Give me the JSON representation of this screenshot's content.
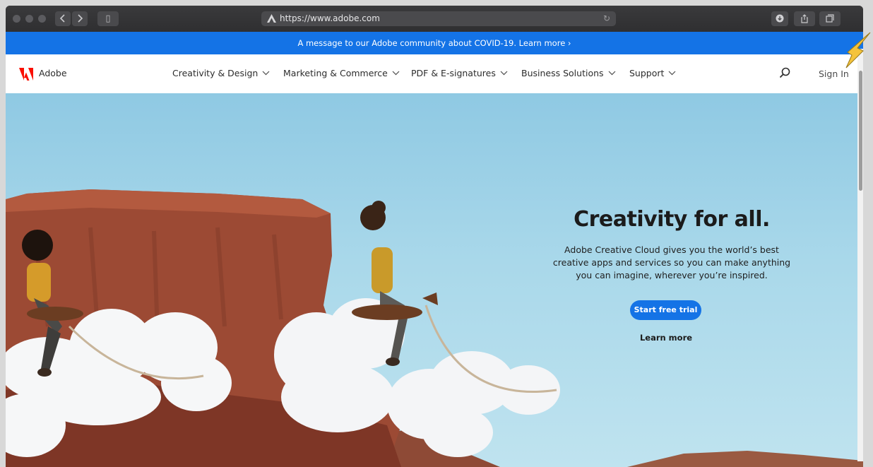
{
  "browser": {
    "url": "https://www.adobe.com",
    "reload_glyph": "↻",
    "sidebar_glyph": "▯"
  },
  "banner": {
    "text": "A message to our Adobe community about COVID-19. Learn more ›"
  },
  "nav": {
    "brand": "Adobe",
    "items": [
      {
        "label": "Creativity & Design"
      },
      {
        "label": "Marketing & Commerce"
      },
      {
        "label": "PDF & E-signatures"
      },
      {
        "label": "Business Solutions"
      },
      {
        "label": "Support"
      }
    ],
    "signin": "Sign In"
  },
  "hero": {
    "title": "Creativity for all.",
    "description": "Adobe Creative Cloud gives you the world’s best creative apps and services so you can make anything you can imagine, wherever you’re inspired.",
    "cta": "Start free trial",
    "learn_more": "Learn more"
  },
  "colors": {
    "accent_blue": "#1473e6",
    "adobe_red": "#fa0f00",
    "annotation_arrow": "#f5c33b"
  },
  "icons": {
    "back": "chevron-left-icon",
    "forward": "chevron-right-icon",
    "download": "download-icon",
    "share": "share-icon",
    "tabs": "tabs-icon",
    "search": "search-icon"
  }
}
